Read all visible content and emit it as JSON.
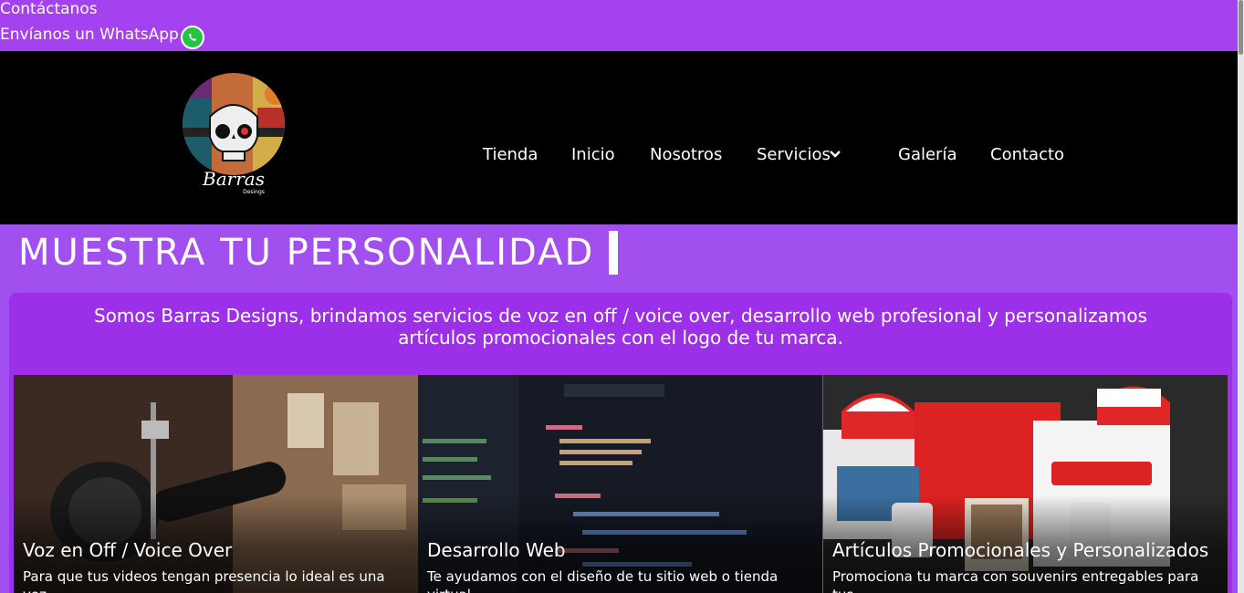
{
  "topbar": {
    "contact": "Contáctanos",
    "whatsapp": "Envíanos un WhatsApp"
  },
  "nav": {
    "items": [
      "Tienda",
      "Inicio",
      "Nosotros",
      "Servicios",
      "Galería",
      "Contacto"
    ]
  },
  "logo": {
    "text": "Barras",
    "subtext": "Desings"
  },
  "hero": {
    "title": "MUESTRA TU PERSONALIDAD",
    "intro": "Somos Barras Designs, brindamos servicios de voz en off / voice over, desarrollo web profesional y personalizamos artículos promocionales con el logo de tu marca."
  },
  "cards": [
    {
      "title": "Voz en Off / Voice Over",
      "text": "Para que tus videos tengan presencia lo ideal es una voz"
    },
    {
      "title": "Desarrollo Web",
      "text": "Te ayudamos con el diseño de tu sitio web o tienda virtual,"
    },
    {
      "title": "Artículos Promocionales y Personalizados",
      "text": "Promociona tu marca con souvenirs entregables para tus"
    }
  ],
  "colors": {
    "accent": "#a442ef",
    "header": "#000000",
    "whatsapp": "#28c246"
  },
  "icons": {
    "whatsapp": "whatsapp-icon",
    "dropdown": "chevron-down-icon"
  }
}
